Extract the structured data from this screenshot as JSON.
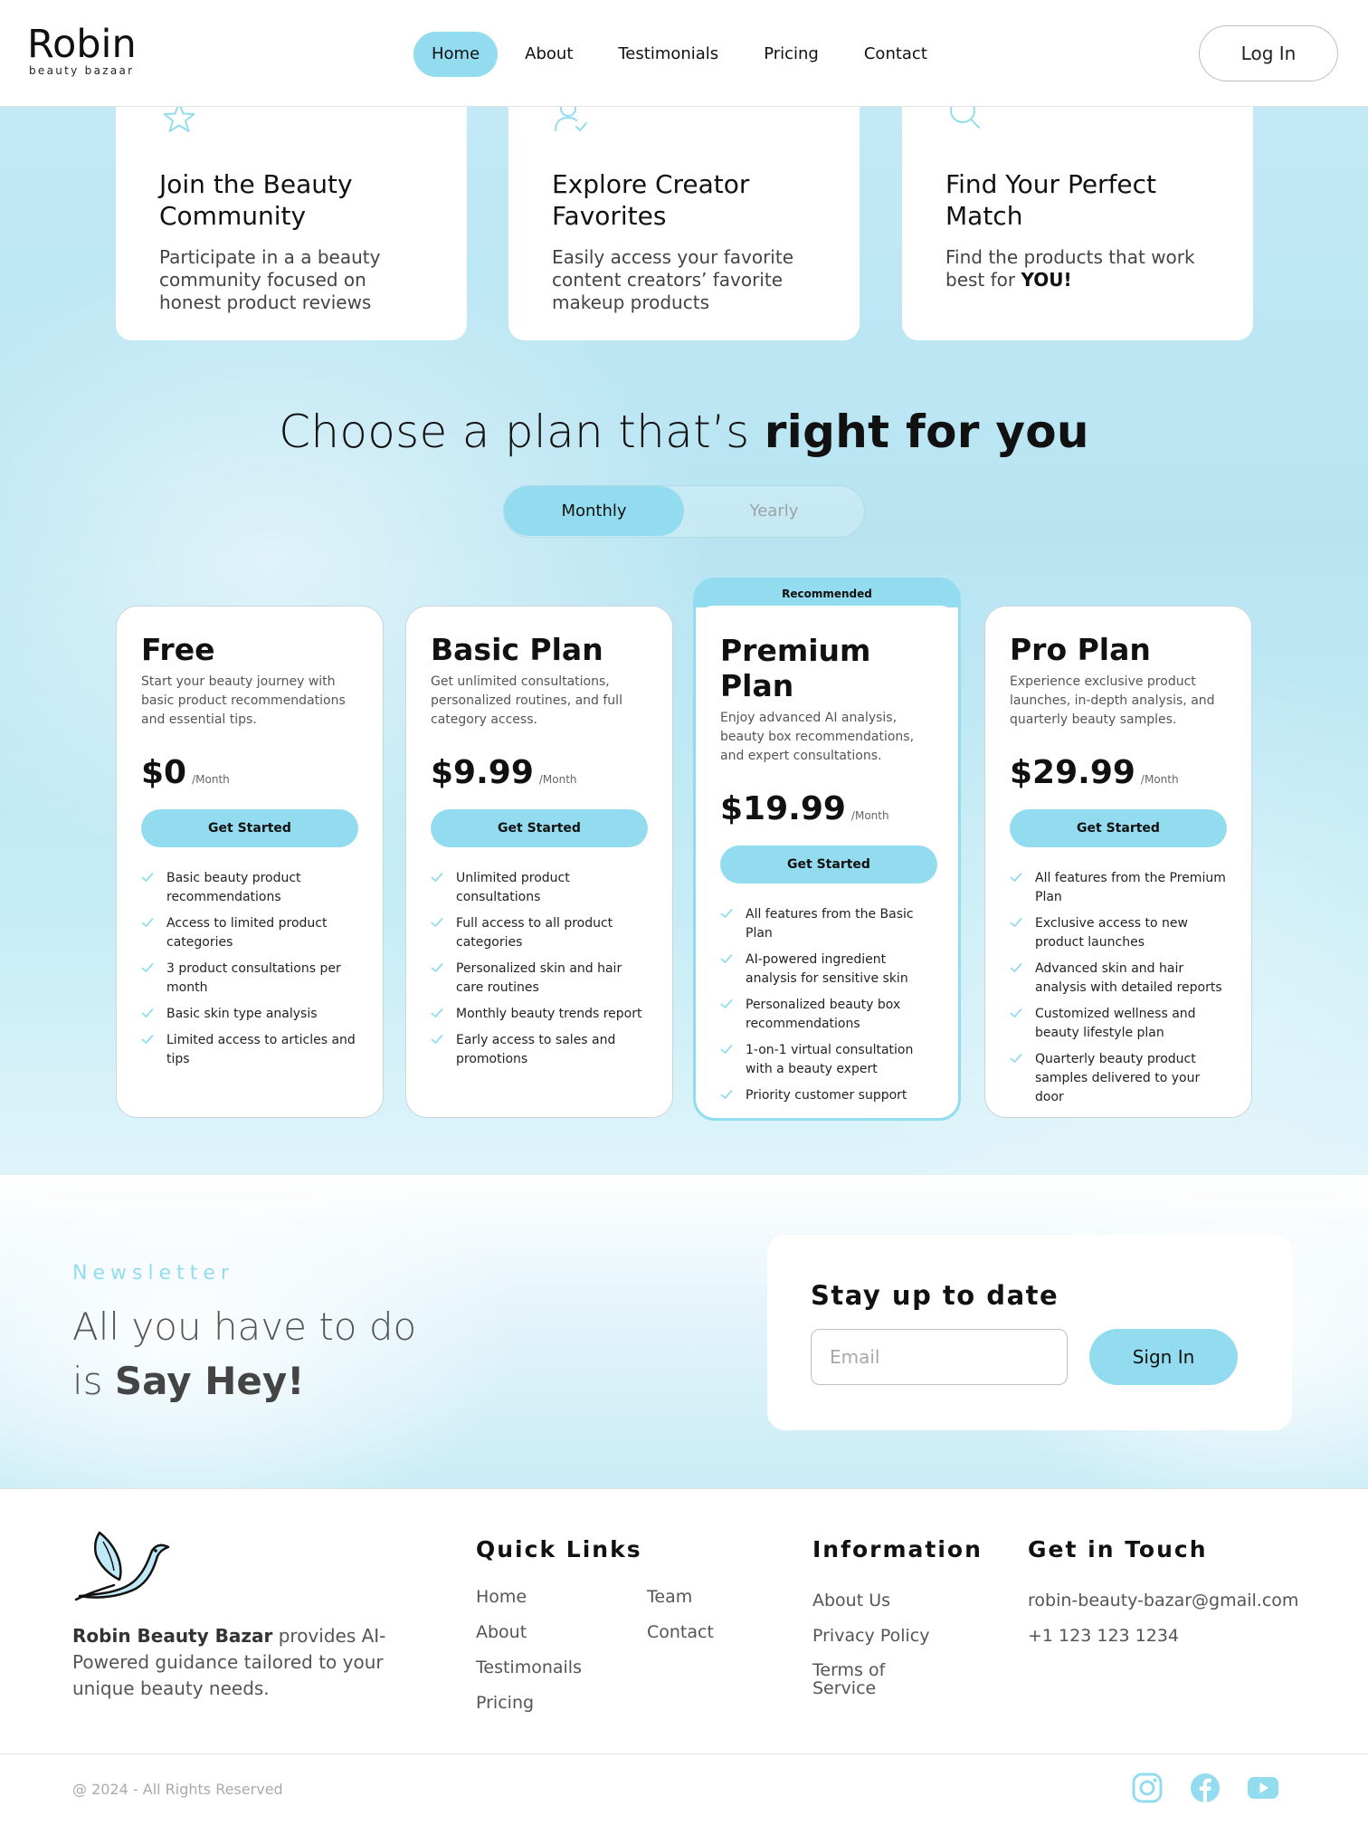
{
  "brand": {
    "name": "Robin",
    "tagline": "beauty bazaar"
  },
  "nav": {
    "links": [
      "Home",
      "About",
      "Testimonials",
      "Pricing",
      "Contact"
    ],
    "active": "Home",
    "login_label": "Log In"
  },
  "features": [
    {
      "icon": "star-icon",
      "title": "Join the Beauty Community",
      "text": "Participate in a a beauty community focused on honest product reviews"
    },
    {
      "icon": "user-check-icon",
      "title": "Explore Creator Favorites",
      "text": "Easily access your favorite content creators’ favorite makeup products"
    },
    {
      "icon": "search-icon",
      "title": "Find Your Perfect Match",
      "text_prefix": "Find the products that work best for ",
      "text_bold": "YOU!"
    }
  ],
  "plans_heading": {
    "light": "Choose a plan that’s ",
    "bold": "right for you"
  },
  "billing_toggle": {
    "monthly": "Monthly",
    "yearly": "Yearly",
    "selected": "Monthly"
  },
  "recommended_label": "Recommended",
  "per_label": "/Month",
  "cta_label": "Get Started",
  "plans": [
    {
      "name": "Free",
      "desc": "Start your beauty journey with basic product recommendations and essential tips.",
      "price": "$0",
      "features": [
        "Basic beauty product recommendations",
        "Access to limited product categories",
        "3 product consultations per month",
        "Basic skin type analysis",
        "Limited access to articles and tips"
      ]
    },
    {
      "name": "Basic Plan",
      "desc": "Get unlimited consultations, personalized routines, and full category access.",
      "price": "$9.99",
      "features": [
        "Unlimited product consultations",
        "Full access to all product categories",
        "Personalized skin and hair care routines",
        "Monthly beauty trends report",
        "Early access to sales and promotions"
      ]
    },
    {
      "name": "Premium Plan",
      "desc": "Enjoy advanced AI analysis, beauty box recommendations, and expert consultations.",
      "price": "$19.99",
      "features": [
        "All features from the Basic Plan",
        "AI-powered ingredient analysis for sensitive skin",
        "Personalized beauty box recommendations",
        "1-on-1 virtual consultation with a beauty expert",
        "Priority customer support"
      ]
    },
    {
      "name": "Pro Plan",
      "desc": "Experience exclusive product launches, in-depth analysis, and quarterly beauty samples.",
      "price": "$29.99",
      "features": [
        "All features from the Premium Plan",
        "Exclusive access to new product launches",
        "Advanced skin and hair analysis with detailed reports",
        "Customized wellness and beauty lifestyle plan",
        "Quarterly beauty product samples delivered to your door"
      ]
    }
  ],
  "newsletter": {
    "eyebrow": "Newsletter",
    "line1": "All you have to do",
    "line2_prefix": "is ",
    "line2_bold": "Say Hey!",
    "card_title": "Stay up to date",
    "email_placeholder": "Email",
    "signin_label": "Sign In"
  },
  "footer": {
    "about_bold": "Robin Beauty Bazar",
    "about_rest": " provides AI-Powered guidance tailored to your unique beauty needs.",
    "quick_links_title": "Quick Links",
    "quick_links_col1": [
      "Home",
      "About",
      "Testimonails",
      "Pricing"
    ],
    "quick_links_col2": [
      "Team",
      "Contact"
    ],
    "information_title": "Information",
    "information_links": [
      "About Us",
      "Privacy Policy",
      "Terms of Service"
    ],
    "contact_title": "Get in Touch",
    "email": "robin-beauty-bazar@gmail.com",
    "phone": "+1 123 123 1234",
    "copyright": "@ 2024 - All Rights Reserved",
    "social": [
      "instagram-icon",
      "facebook-icon",
      "youtube-icon"
    ]
  },
  "colors": {
    "accent": "#93dcf0",
    "background_blue": "#c2e9f5"
  }
}
